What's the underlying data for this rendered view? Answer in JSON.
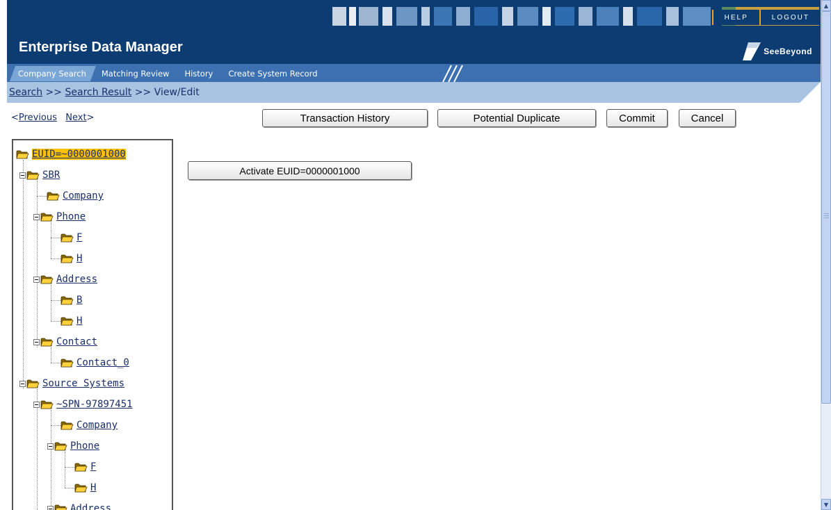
{
  "header": {
    "app_title": "Enterprise Data Manager",
    "help_label": "HELP",
    "logout_label": "LOGOUT",
    "logo_text": "SeeBeyond",
    "colors": {
      "header_bg": "#0c3c72",
      "tab_bar": "#3c70b0",
      "active_tab": "#7aa6d6",
      "breadcrumb_bar": "#a8c4e2",
      "accent": "#f0a020"
    }
  },
  "tabs": [
    {
      "label": "Company Search",
      "active": true
    },
    {
      "label": "Matching Review",
      "active": false
    },
    {
      "label": "History",
      "active": false
    },
    {
      "label": "Create System Record",
      "active": false
    }
  ],
  "breadcrumb": {
    "search": "Search",
    "sep1": " >> ",
    "search_result": "Search Result",
    "sep2": " >> ",
    "current": "View/Edit"
  },
  "nav": {
    "prev_prefix": "<",
    "previous": "Previous",
    "next": "Next",
    "next_suffix": ">"
  },
  "toolbar": {
    "transaction_history": "Transaction History",
    "potential_duplicate": "Potential Duplicate",
    "commit": "Commit",
    "cancel": "Cancel"
  },
  "main": {
    "activate_button": "Activate EUID=0000001000"
  },
  "tree": {
    "root": "EUID=~0000001000",
    "sbr": "SBR",
    "sbr_company": "Company",
    "sbr_phone": "Phone",
    "sbr_phone_f": "F",
    "sbr_phone_h": "H",
    "sbr_address": "Address",
    "sbr_address_b": "B",
    "sbr_address_h": "H",
    "sbr_contact": "Contact",
    "sbr_contact_0": "Contact_0",
    "source_systems": "Source Systems",
    "spn": "~SPN-97897451",
    "spn_company": "Company",
    "spn_phone": "Phone",
    "spn_phone_f": "F",
    "spn_phone_h": "H",
    "spn_address": "Address"
  }
}
